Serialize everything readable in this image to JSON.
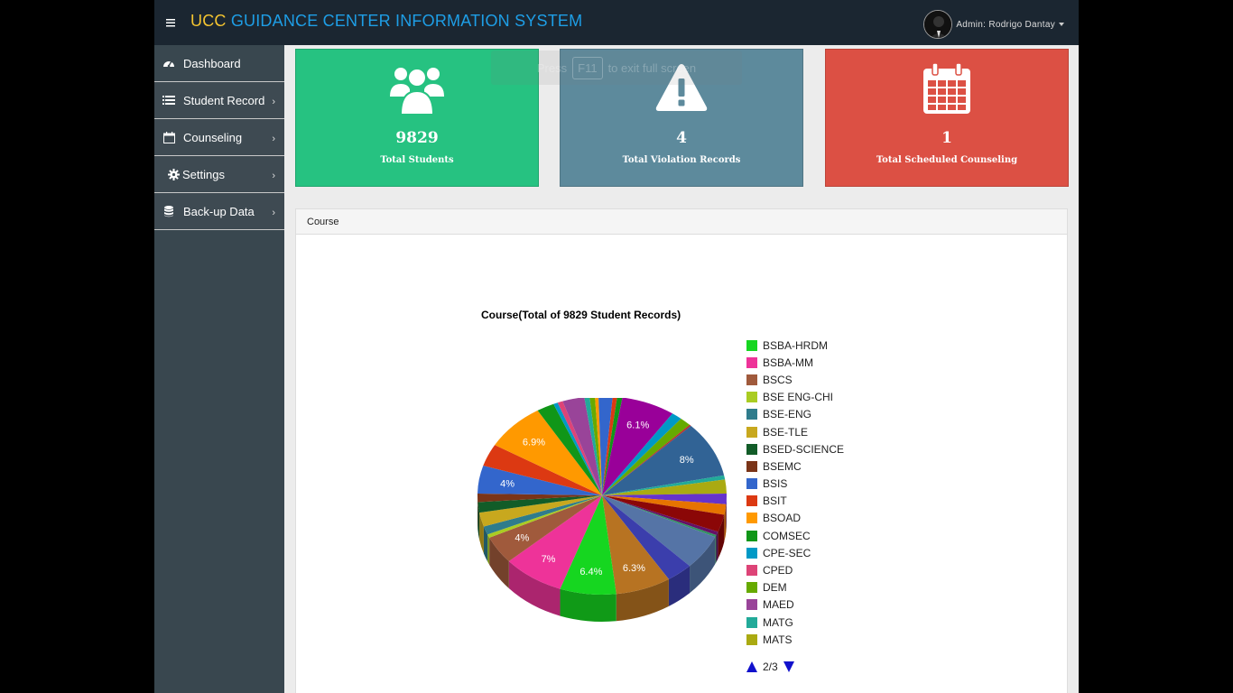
{
  "app": {
    "brand": "UCC",
    "title": "GUIDANCE CENTER INFORMATION SYSTEM",
    "menu_icon": "hamburger-icon"
  },
  "user": {
    "label": "Admin: Rodrigo Dantay"
  },
  "sidebar": {
    "items": [
      {
        "label": "Dashboard",
        "icon": "dashboard-icon"
      },
      {
        "label": "Student Record",
        "icon": "list-icon"
      },
      {
        "label": "Counseling",
        "icon": "calendar-icon"
      },
      {
        "label": "Settings",
        "icon": "gear-icon"
      },
      {
        "label": "Back-up Data",
        "icon": "database-icon"
      }
    ]
  },
  "fullscreen_hint": {
    "pre": "Press",
    "key": "F11",
    "post": "to exit full screen"
  },
  "cards": [
    {
      "value": "9829",
      "label": "Total Students",
      "color": "#26c281",
      "icon": "users-icon"
    },
    {
      "value": "4",
      "label": "Total Violation Records",
      "color": "#5d8a9c",
      "icon": "warning-icon"
    },
    {
      "value": "1",
      "label": "Total Scheduled Counseling",
      "color": "#dc5044",
      "icon": "calendar-icon"
    }
  ],
  "panel": {
    "heading": "Course"
  },
  "chart_data": {
    "type": "pie",
    "title": "Course(Total of 9829 Student Records)",
    "slices": [
      {
        "color": "#3366cc",
        "value": 1.2
      },
      {
        "color": "#dc3912",
        "value": 0.5
      },
      {
        "color": "#109618",
        "value": 0.6
      },
      {
        "color": "#990099",
        "value": 6.1,
        "label": "6.1%"
      },
      {
        "color": "#0099c6",
        "value": 1.2
      },
      {
        "color": "#66aa00",
        "value": 1.3
      },
      {
        "color": "#b82e2e",
        "value": 0.2
      },
      {
        "color": "#316395",
        "value": 8,
        "label": "8%"
      },
      {
        "color": "#22aa99",
        "value": 0.6
      },
      {
        "color": "#aaaa11",
        "value": 2
      },
      {
        "color": "#6633cc",
        "value": 1.5
      },
      {
        "color": "#e67300",
        "value": 1.5
      },
      {
        "color": "#8b0707",
        "value": 2.5
      },
      {
        "color": "#651067",
        "value": 0.5
      },
      {
        "color": "#329262",
        "value": 0.3
      },
      {
        "color": "#5574a6",
        "value": 5
      },
      {
        "color": "#3b3eac",
        "value": 3
      },
      {
        "color": "#b77322",
        "value": 6.3,
        "label": "6.3%"
      },
      {
        "color": "#16d620",
        "value": 6.4,
        "label": "6.4%"
      },
      {
        "color": "#ee3399",
        "value": 7,
        "label": "7%"
      },
      {
        "color": "#a05a3c",
        "value": 4,
        "label": "4%"
      },
      {
        "color": "#aacc22",
        "value": 0.5
      },
      {
        "color": "#2f7c8c",
        "value": 1.2
      },
      {
        "color": "#c8a81e",
        "value": 2
      },
      {
        "color": "#125c28",
        "value": 1.5
      },
      {
        "color": "#7a3418",
        "value": 1.2
      },
      {
        "color": "#3366cc",
        "value": 4,
        "label": "4%"
      },
      {
        "color": "#dc3912",
        "value": 3.2
      },
      {
        "color": "#ff9900",
        "value": 6.9,
        "label": "6.9%"
      },
      {
        "color": "#109618",
        "value": 2
      },
      {
        "color": "#0099c6",
        "value": 0.5
      },
      {
        "color": "#dd4477",
        "value": 0.6
      },
      {
        "color": "#994499",
        "value": 2.5
      },
      {
        "color": "#22aa99",
        "value": 0.6
      },
      {
        "color": "#66aa00",
        "value": 0.6
      },
      {
        "color": "#ff9900",
        "value": 0.4
      },
      {
        "color": "#3366cc",
        "value": 0.4
      }
    ],
    "legend": [
      {
        "label": "BSBA-HRDM",
        "color": "#16d620"
      },
      {
        "label": "BSBA-MM",
        "color": "#ee3399"
      },
      {
        "label": "BSCS",
        "color": "#a05a3c"
      },
      {
        "label": "BSE ENG-CHI",
        "color": "#aacc22"
      },
      {
        "label": "BSE-ENG",
        "color": "#2f7c8c"
      },
      {
        "label": "BSE-TLE",
        "color": "#c8a81e"
      },
      {
        "label": "BSED-SCIENCE",
        "color": "#125c28"
      },
      {
        "label": "BSEMC",
        "color": "#7a3418"
      },
      {
        "label": "BSIS",
        "color": "#3366cc"
      },
      {
        "label": "BSIT",
        "color": "#dc3912"
      },
      {
        "label": "BSOAD",
        "color": "#ff9900"
      },
      {
        "label": "COMSEC",
        "color": "#109618"
      },
      {
        "label": "CPE-SEC",
        "color": "#0099c6"
      },
      {
        "label": "CPED",
        "color": "#dd4477"
      },
      {
        "label": "DEM",
        "color": "#66aa00"
      },
      {
        "label": "MAED",
        "color": "#994499"
      },
      {
        "label": "MATG",
        "color": "#22aa99"
      },
      {
        "label": "MATS",
        "color": "#aaaa11"
      }
    ],
    "legend_page": "2/3"
  }
}
